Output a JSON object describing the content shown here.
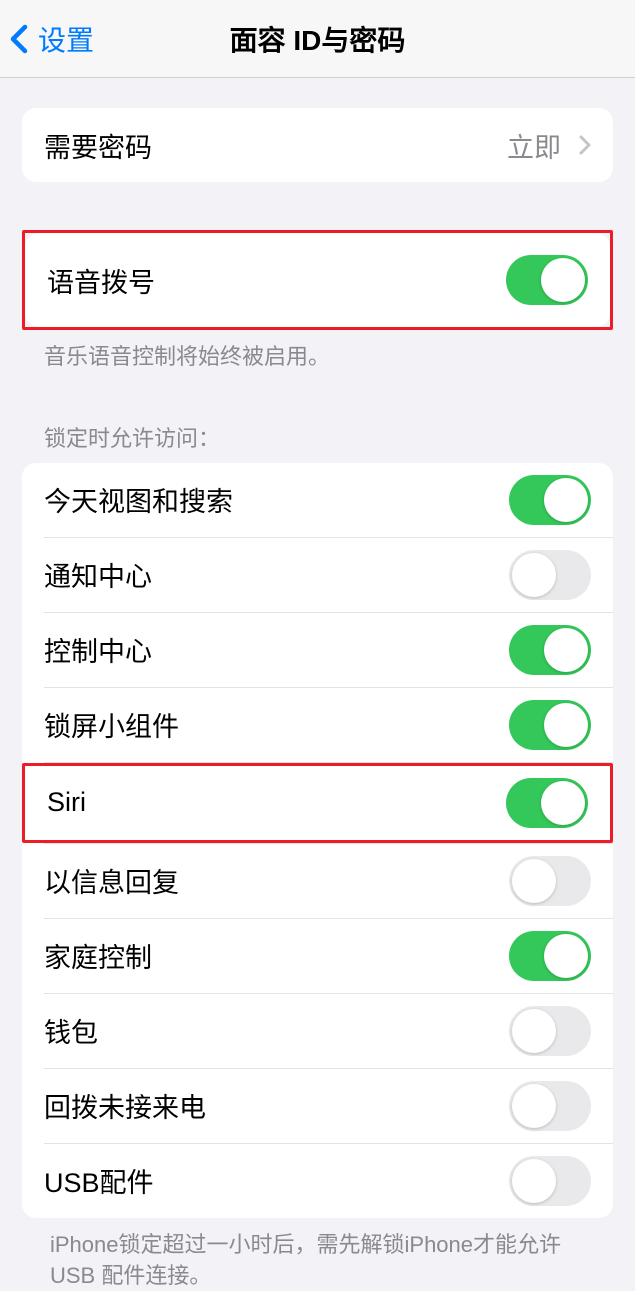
{
  "nav": {
    "back_label": "设置",
    "title": "面容 ID与密码"
  },
  "require_passcode": {
    "label": "需要密码",
    "value": "立即"
  },
  "voice_dial": {
    "label": "语音拨号",
    "enabled": true
  },
  "voice_footnote": "音乐语音控制将始终被启用。",
  "locked_access_header": "锁定时允许访问：",
  "locked_items": [
    {
      "label": "今天视图和搜索",
      "enabled": true
    },
    {
      "label": "通知中心",
      "enabled": false
    },
    {
      "label": "控制中心",
      "enabled": true
    },
    {
      "label": "锁屏小组件",
      "enabled": true
    },
    {
      "label": "Siri",
      "enabled": true
    },
    {
      "label": "以信息回复",
      "enabled": false
    },
    {
      "label": "家庭控制",
      "enabled": true
    },
    {
      "label": "钱包",
      "enabled": false
    },
    {
      "label": "回拨未接来电",
      "enabled": false
    },
    {
      "label": "USB配件",
      "enabled": false
    }
  ],
  "usb_footnote": "iPhone锁定超过一小时后，需先解锁iPhone才能允许USB 配件连接。",
  "highlights": {
    "voice_dial": true,
    "siri_index": 4
  }
}
